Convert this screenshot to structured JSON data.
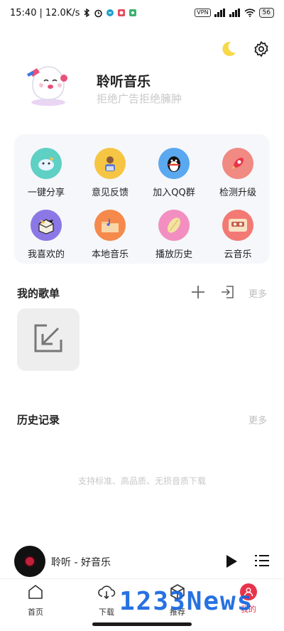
{
  "status_bar": {
    "time": "15:40",
    "network_speed": "12.0K/s",
    "vpn_label": "VPN",
    "battery": "56"
  },
  "profile": {
    "app_name": "聆听音乐",
    "slogan": "拒绝广告拒绝臃肿"
  },
  "grid": [
    {
      "label": "一键分享",
      "icon": "share-cloud-icon",
      "color": "#5fd0c4"
    },
    {
      "label": "意见反馈",
      "icon": "feedback-person-icon",
      "color": "#f6c544"
    },
    {
      "label": "加入QQ群",
      "icon": "qq-penguin-icon",
      "color": "#5aa8f0"
    },
    {
      "label": "检测升级",
      "icon": "rocket-icon",
      "color": "#f08a82"
    },
    {
      "label": "我喜欢的",
      "icon": "favorite-box-icon",
      "color": "#8b78e6"
    },
    {
      "label": "本地音乐",
      "icon": "folder-music-icon",
      "color": "#f58a4c"
    },
    {
      "label": "播放历史",
      "icon": "history-leaf-icon",
      "color": "#f28fc0"
    },
    {
      "label": "云音乐",
      "icon": "cassette-icon",
      "color": "#f37a74"
    }
  ],
  "playlists": {
    "title": "我的歌单",
    "more": "更多"
  },
  "history": {
    "title": "历史记录",
    "more": "更多",
    "empty_hint": "支持标准、高品质、无损音质下载"
  },
  "player": {
    "track": "聆听 - 好音乐"
  },
  "nav": [
    {
      "label": "首页",
      "icon": "home-icon"
    },
    {
      "label": "下载",
      "icon": "cloud-download-icon"
    },
    {
      "label": "推荐",
      "icon": "cube-icon"
    },
    {
      "label": "我的",
      "icon": "user-icon"
    }
  ],
  "watermark": "1233News",
  "colors": {
    "accent_red": "#e8344a",
    "card_bg": "#f6f7fb",
    "muted_text": "#c9c9c9"
  }
}
